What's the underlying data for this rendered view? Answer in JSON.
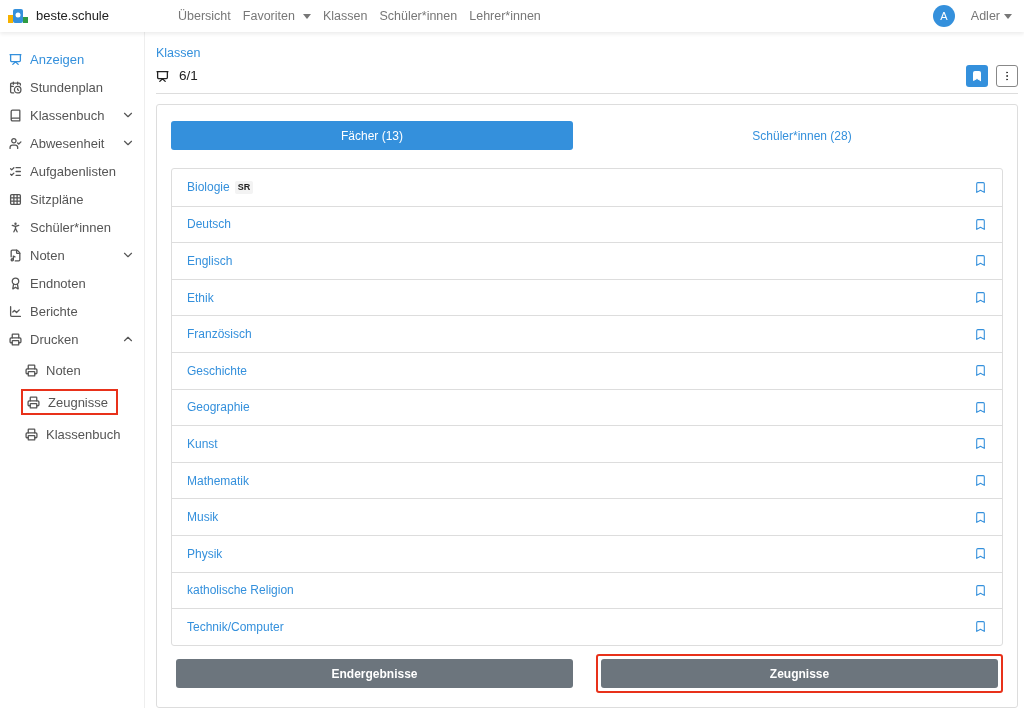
{
  "brand": "beste.schule",
  "nav": [
    {
      "label": "Übersicht",
      "dropdown": false
    },
    {
      "label": "Favoriten",
      "dropdown": true
    },
    {
      "label": "Klassen",
      "dropdown": false
    },
    {
      "label": "Schüler*innen",
      "dropdown": false
    },
    {
      "label": "Lehrer*innen",
      "dropdown": false
    }
  ],
  "user": {
    "initial": "A",
    "name": "Adler"
  },
  "sidebar": {
    "items": [
      {
        "label": "Anzeigen",
        "kind": "board",
        "selected": true,
        "highlighted": false
      },
      {
        "label": "Stundenplan",
        "kind": "calendar",
        "selected": false,
        "highlighted": false
      },
      {
        "label": "Klassenbuch",
        "kind": "book",
        "selected": false,
        "expanded": false,
        "highlighted": false
      },
      {
        "label": "Abwesenheit",
        "kind": "absence",
        "selected": false,
        "expanded": false,
        "highlighted": false
      },
      {
        "label": "Aufgabenlisten",
        "kind": "list",
        "selected": false,
        "highlighted": false
      },
      {
        "label": "Sitzpläne",
        "kind": "grid",
        "selected": false,
        "highlighted": false
      },
      {
        "label": "Schüler*innen",
        "kind": "person",
        "selected": false,
        "highlighted": false
      },
      {
        "label": "Noten",
        "kind": "file",
        "selected": false,
        "expanded": false,
        "highlighted": false
      },
      {
        "label": "Endnoten",
        "kind": "award",
        "selected": false,
        "highlighted": false
      },
      {
        "label": "Berichte",
        "kind": "chart",
        "selected": false,
        "highlighted": false
      },
      {
        "label": "Drucken",
        "kind": "printer",
        "selected": false,
        "expanded": true,
        "highlighted": false,
        "children": [
          {
            "label": "Noten",
            "kind": "printer",
            "selected": false,
            "highlighted": false
          },
          {
            "label": "Zeugnisse",
            "kind": "printer",
            "selected": false,
            "highlighted": true
          },
          {
            "label": "Klassenbuch",
            "kind": "printer",
            "selected": false,
            "highlighted": false
          }
        ]
      }
    ]
  },
  "breadcrumb": "Klassen",
  "class_name": "6/1",
  "bookmarked": true,
  "tabs": [
    {
      "label": "Fächer (13)",
      "selected": true
    },
    {
      "label": "Schüler*innen (28)",
      "selected": false
    }
  ],
  "subjects": [
    {
      "name": "Biologie",
      "badge": "SR"
    },
    {
      "name": "Deutsch"
    },
    {
      "name": "Englisch"
    },
    {
      "name": "Ethik"
    },
    {
      "name": "Französisch"
    },
    {
      "name": "Geschichte"
    },
    {
      "name": "Geographie"
    },
    {
      "name": "Kunst"
    },
    {
      "name": "Mathematik"
    },
    {
      "name": "Musik"
    },
    {
      "name": "Physik"
    },
    {
      "name": "katholische Religion"
    },
    {
      "name": "Technik/Computer"
    }
  ],
  "buttons": [
    {
      "label": "Endergebnisse",
      "highlighted": false
    },
    {
      "label": "Zeugnisse",
      "highlighted": true
    }
  ]
}
